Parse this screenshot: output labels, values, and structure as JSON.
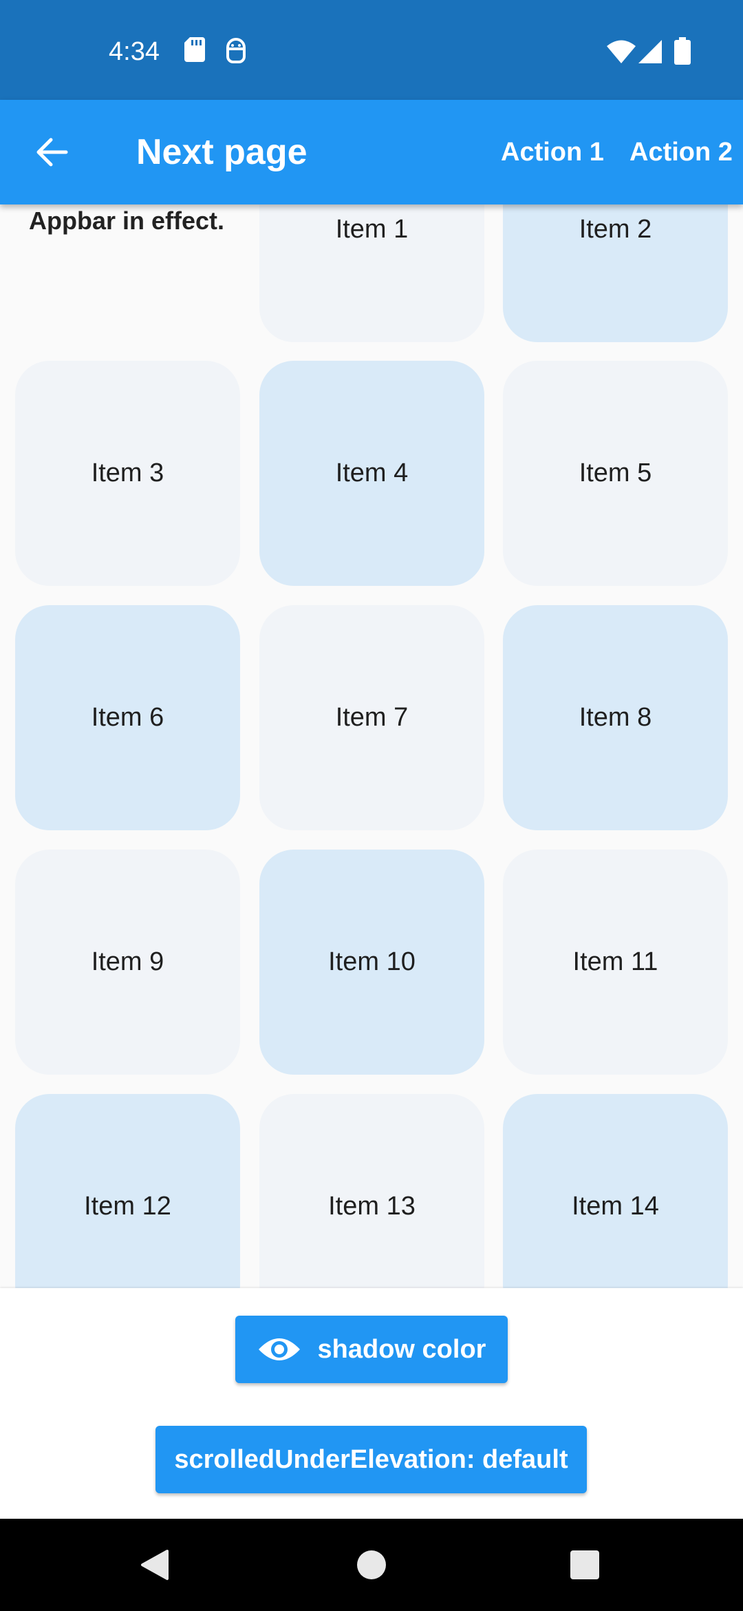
{
  "status_bar": {
    "time": "4:34",
    "icons": [
      "sd-card-icon",
      "android-debug-icon",
      "wifi-icon",
      "signal-icon",
      "battery-icon"
    ]
  },
  "app_bar": {
    "back_icon": "arrow-left-icon",
    "title": "Next page",
    "actions": [
      "Action 1",
      "Action 2"
    ]
  },
  "content": {
    "intro_text": "Appbar in effect.",
    "items": [
      "Item 1",
      "Item 2",
      "Item 3",
      "Item 4",
      "Item 5",
      "Item 6",
      "Item 7",
      "Item 8",
      "Item 9",
      "Item 10",
      "Item 11",
      "Item 12",
      "Item 13",
      "Item 14"
    ]
  },
  "controls": {
    "shadow_color_label": "shadow color",
    "shadow_color_icon": "eye-icon",
    "elevation_label": "scrolledUnderElevation: default"
  },
  "nav_bar": {
    "icons": [
      "back-triangle-icon",
      "home-circle-icon",
      "recents-square-icon"
    ]
  },
  "colors": {
    "status_bar": "#1a72bb",
    "app_bar": "#2196f3",
    "tile_light": "#f1f4f8",
    "tile_dark": "#d9eaf8",
    "button": "#2196f3"
  }
}
